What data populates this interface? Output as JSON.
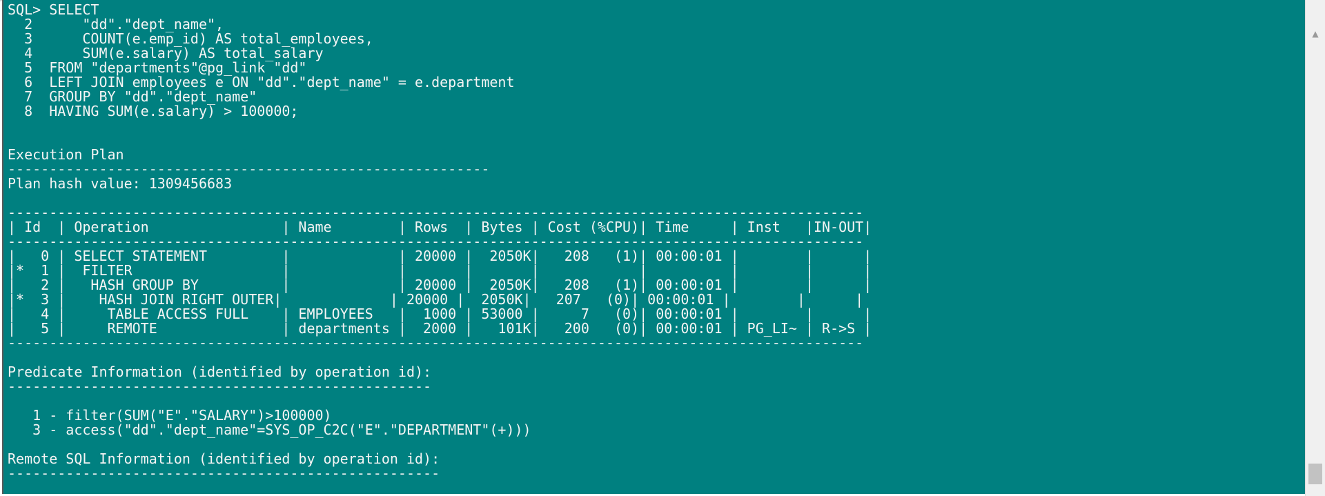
{
  "terminal": {
    "lines": [
      "SQL> SELECT",
      "  2      \"dd\".\"dept_name\",",
      "  3      COUNT(e.emp_id) AS total_employees,",
      "  4      SUM(e.salary) AS total_salary",
      "  5  FROM \"departments\"@pg_link \"dd\"",
      "  6  LEFT JOIN employees e ON \"dd\".\"dept_name\" = e.department",
      "  7  GROUP BY \"dd\".\"dept_name\"",
      "  8  HAVING SUM(e.salary) > 100000;",
      "",
      "",
      "Execution Plan",
      "----------------------------------------------------------",
      "Plan hash value: 1309456683",
      "",
      "-------------------------------------------------------------------------------------------------------",
      "| Id  | Operation                | Name        | Rows  | Bytes | Cost (%CPU)| Time     | Inst   |IN-OUT|",
      "-------------------------------------------------------------------------------------------------------",
      "|   0 | SELECT STATEMENT         |             | 20000 |  2050K|   208   (1)| 00:00:01 |        |      |",
      "|*  1 |  FILTER                  |             |       |       |            |          |        |      |",
      "|   2 |   HASH GROUP BY          |             | 20000 |  2050K|   208   (1)| 00:00:01 |        |      |",
      "|*  3 |    HASH JOIN RIGHT OUTER|             | 20000 |  2050K|   207   (0)| 00:00:01 |        |      |",
      "|   4 |     TABLE ACCESS FULL    | EMPLOYEES   |  1000 | 53000 |     7   (0)| 00:00:01 |        |      |",
      "|   5 |     REMOTE               | departments |  2000 |   101K|   200   (0)| 00:00:01 | PG_LI~ | R->S |",
      "-------------------------------------------------------------------------------------------------------",
      "",
      "Predicate Information (identified by operation id):",
      "---------------------------------------------------",
      "",
      "   1 - filter(SUM(\"E\".\"SALARY\")>100000)",
      "   3 - access(\"dd\".\"dept_name\"=SYS_OP_C2C(\"E\".\"DEPARTMENT\"(+)))",
      "",
      "Remote SQL Information (identified by operation id):",
      "----------------------------------------------------"
    ]
  },
  "scrollbar": {
    "up_arrow": "▲"
  }
}
